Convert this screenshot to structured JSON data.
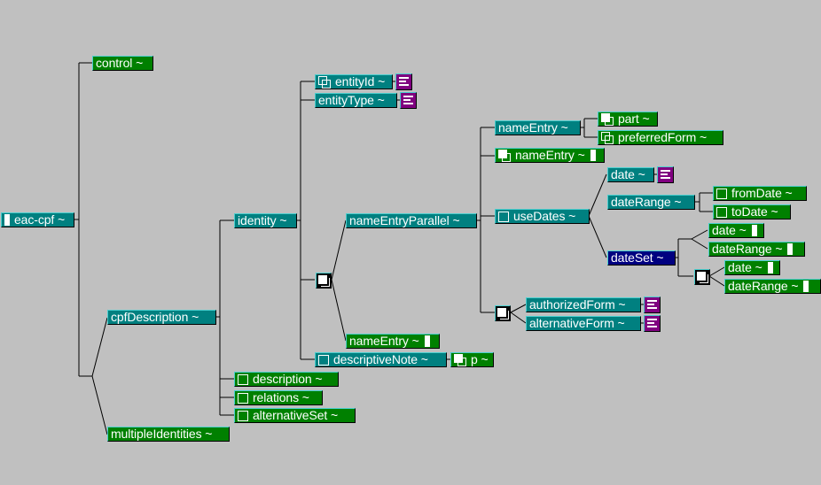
{
  "diagram": {
    "root": "eac-cpf ~",
    "nodes": {
      "control": "control ~",
      "cpfDescription": "cpfDescription ~",
      "multipleIdentities": "multipleIdentities ~",
      "identity": "identity ~",
      "entityId": "entityId ~",
      "entityType": "entityType ~",
      "nameEntryParallel": "nameEntryParallel ~",
      "nameEntryChoice": "nameEntry ~",
      "descriptiveNote": "descriptiveNote ~",
      "p": "p ~",
      "description": "description ~",
      "relations": "relations ~",
      "alternativeSet": "alternativeSet ~",
      "nameEntry1": "nameEntry ~",
      "part": "part ~",
      "preferredForm": "preferredForm ~",
      "nameEntry2": "nameEntry ~",
      "useDates": "useDates ~",
      "date1": "date ~",
      "dateRange1": "dateRange ~",
      "fromDate": "fromDate ~",
      "toDate": "toDate ~",
      "dateSet": "dateSet ~",
      "date2": "date ~",
      "dateRange2": "dateRange ~",
      "date3": "date ~",
      "dateRange3": "dateRange ~",
      "authorizedForm": "authorizedForm ~",
      "alternativeForm": "alternativeForm ~"
    },
    "selected": "dateSet ~",
    "colors": {
      "background": "#c0c0c0",
      "element": "#008080",
      "optional_element": "#008000",
      "selected": "#000080",
      "text_content": "#800080"
    }
  }
}
